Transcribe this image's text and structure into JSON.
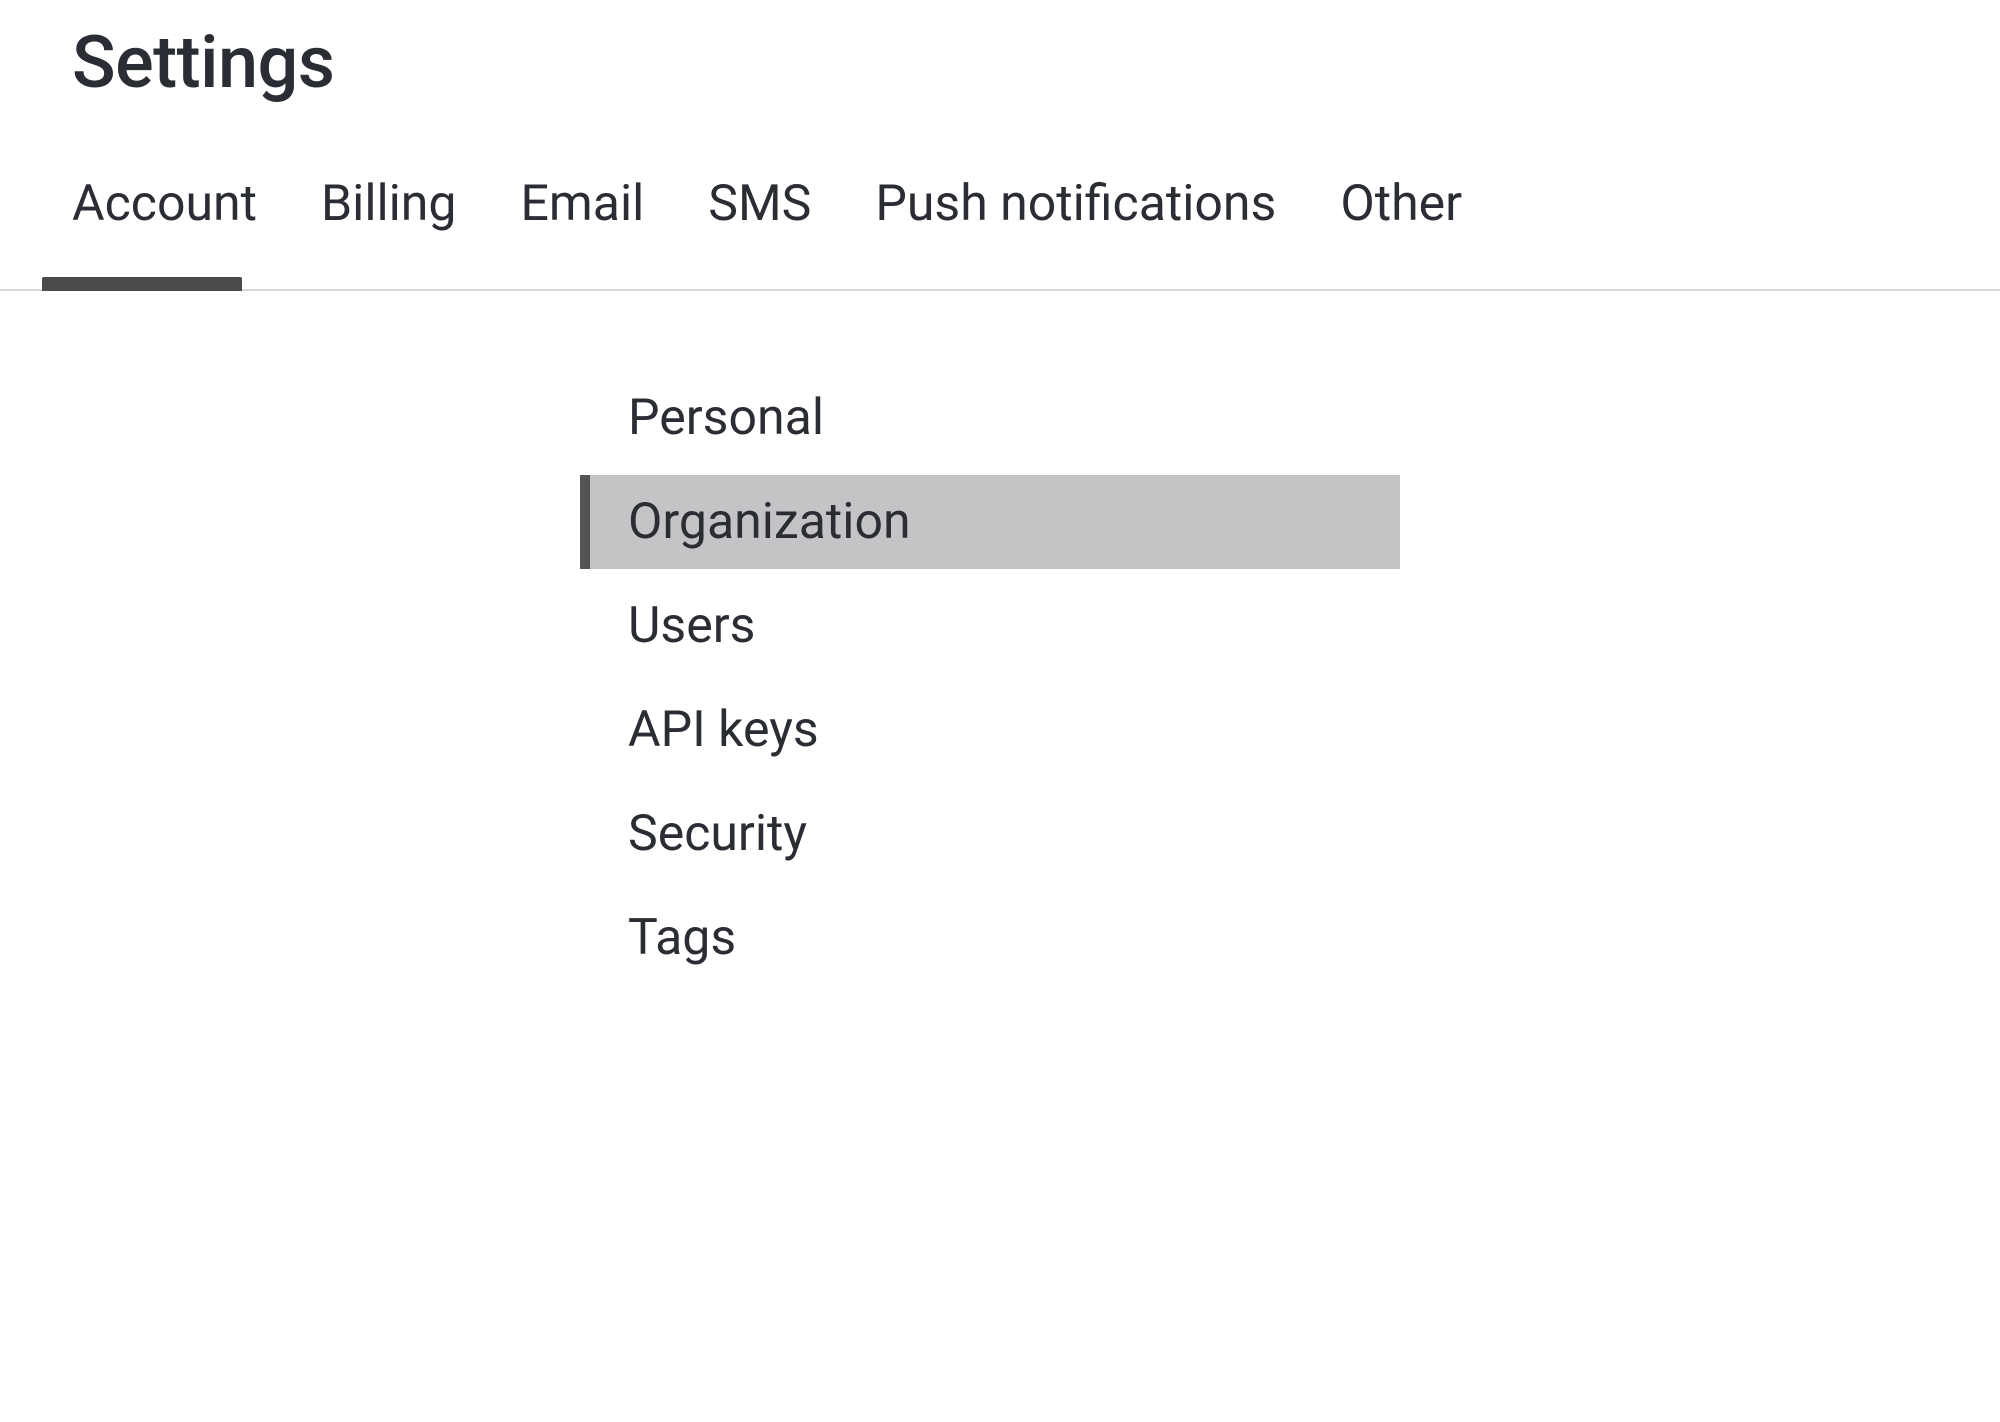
{
  "page": {
    "title": "Settings"
  },
  "tabs": [
    {
      "label": "Account",
      "active": true
    },
    {
      "label": "Billing",
      "active": false
    },
    {
      "label": "Email",
      "active": false
    },
    {
      "label": "SMS",
      "active": false
    },
    {
      "label": "Push notifications",
      "active": false
    },
    {
      "label": "Other",
      "active": false
    }
  ],
  "submenu": [
    {
      "label": "Personal",
      "selected": false
    },
    {
      "label": "Organization",
      "selected": true
    },
    {
      "label": "Users",
      "selected": false
    },
    {
      "label": "API keys",
      "selected": false
    },
    {
      "label": "Security",
      "selected": false
    },
    {
      "label": "Tags",
      "selected": false
    }
  ]
}
